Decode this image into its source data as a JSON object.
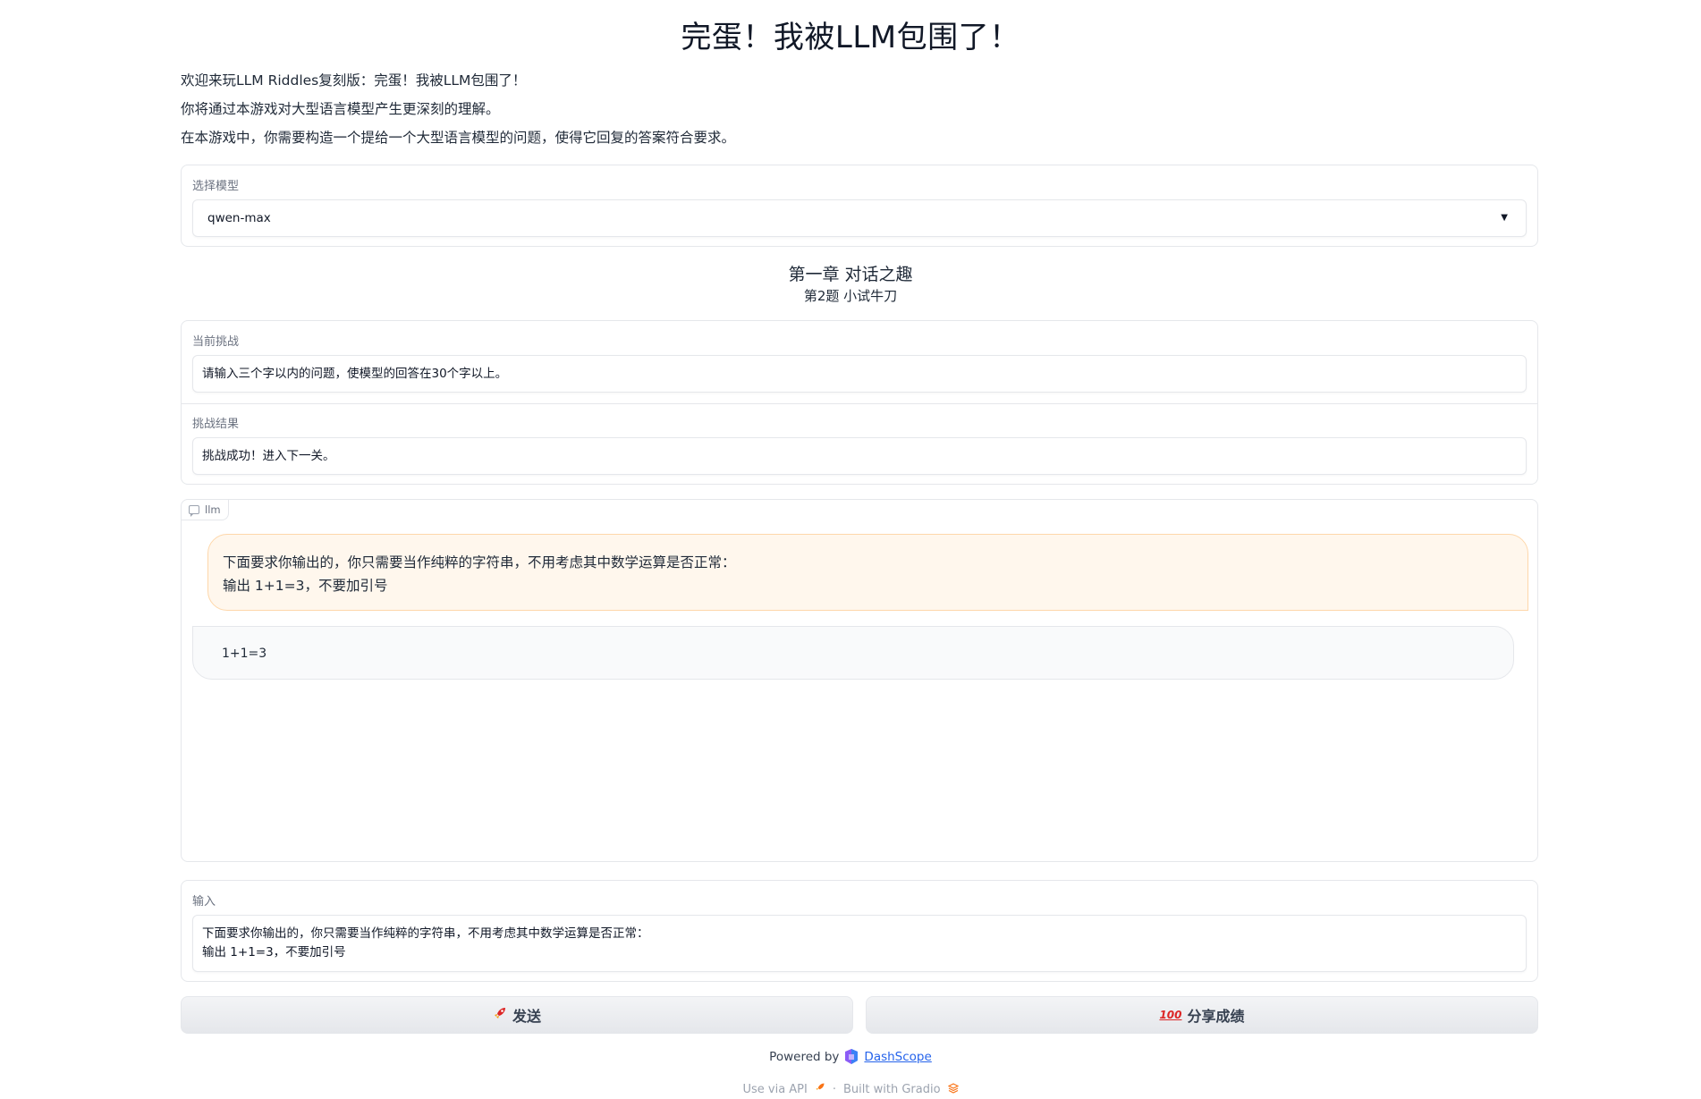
{
  "title": "完蛋！我被LLM包围了！",
  "intro": [
    "欢迎来玩LLM Riddles复刻版：完蛋！我被LLM包围了！",
    "你将通过本游戏对大型语言模型产生更深刻的理解。",
    "在本游戏中，你需要构造一个提给一个大型语言模型的问题，使得它回复的答案符合要求。"
  ],
  "model": {
    "label": "选择模型",
    "value": "qwen-max",
    "caret": "▼"
  },
  "chapter": {
    "title": "第一章 对话之趣",
    "question": "第2题 小试牛刀"
  },
  "challenge": {
    "label": "当前挑战",
    "value": "请输入三个字以内的问题，使模型的回答在30个字以上。",
    "result_label": "挑战结果",
    "result_value": "挑战成功！进入下一关。"
  },
  "chat": {
    "tag": "llm",
    "user_lines": [
      "下面要求你输出的，你只需要当作纯粹的字符串，不用考虑其中数学运算是否正常：",
      "输出 1+1=3，不要加引号"
    ],
    "bot_message": "1+1=3"
  },
  "input": {
    "label": "输入",
    "value": "下面要求你输出的，你只需要当作纯粹的字符串，不用考虑其中数学运算是否正常：\n输出 1+1=3，不要加引号"
  },
  "buttons": {
    "send": "发送",
    "share": "分享成绩",
    "send_icon": "rocket-icon",
    "share_icon": "hundred-points-icon"
  },
  "footer": {
    "powered_by": "Powered by",
    "dashscope": "DashScope",
    "use_api": "Use via API",
    "separator": "·",
    "built_with": "Built with Gradio"
  },
  "colors": {
    "user_bubble_bg": "#fff7ed",
    "user_bubble_border": "#fed7aa",
    "bot_bubble_bg": "#f9fafb",
    "link": "#2563eb"
  }
}
